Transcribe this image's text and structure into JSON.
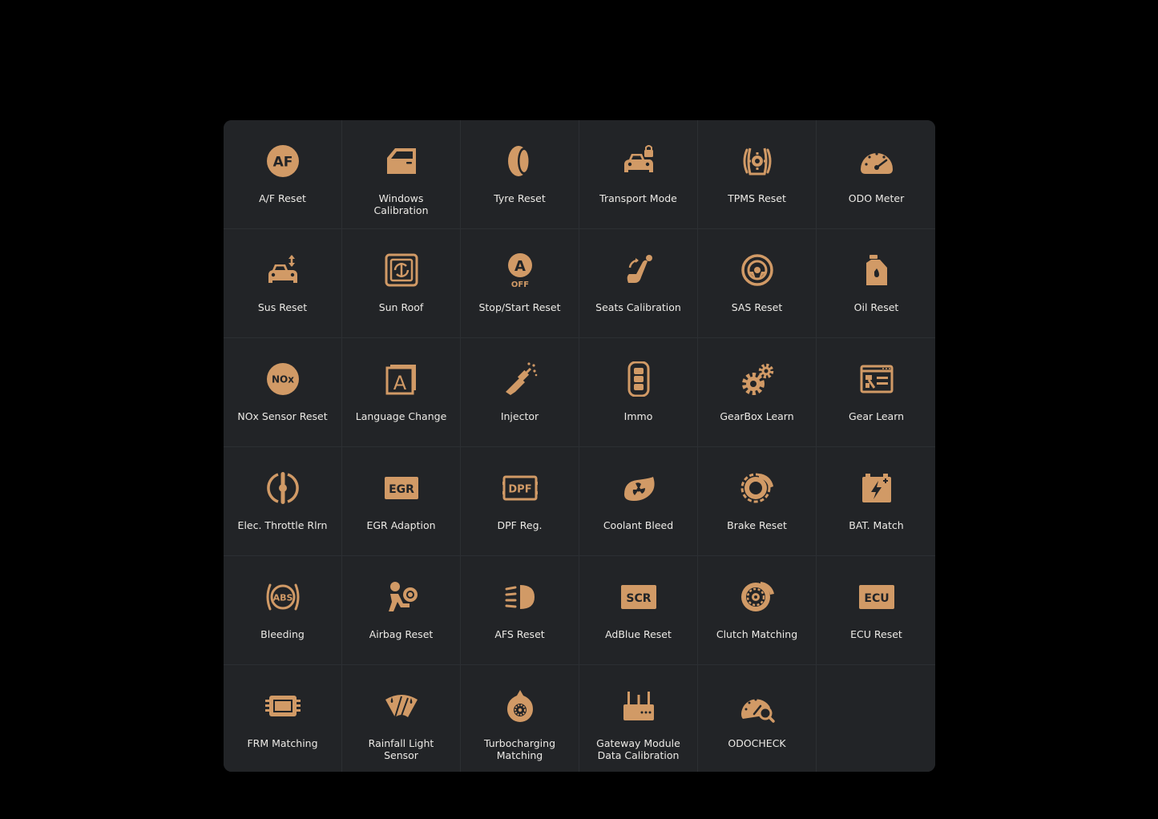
{
  "accent_color": "#d19a66",
  "panel_background": "#222427",
  "functions": [
    {
      "label": "A/F Reset",
      "icon": "af-icon",
      "badge": "AF"
    },
    {
      "label": "Windows\nCalibration",
      "icon": "car-window-icon"
    },
    {
      "label": "Tyre Reset",
      "icon": "tyre-icon"
    },
    {
      "label": "Transport Mode",
      "icon": "car-lock-icon"
    },
    {
      "label": "TPMS Reset",
      "icon": "tpms-icon"
    },
    {
      "label": "ODO Meter",
      "icon": "odometer-icon"
    },
    {
      "label": "Sus Reset",
      "icon": "suspension-icon"
    },
    {
      "label": "Sun Roof",
      "icon": "sunroof-icon"
    },
    {
      "label": "Stop/Start Reset",
      "icon": "stop-start-icon",
      "badge": "A",
      "sub_badge": "OFF"
    },
    {
      "label": "Seats Calibration",
      "icon": "seat-icon"
    },
    {
      "label": "SAS Reset",
      "icon": "steering-angle-icon"
    },
    {
      "label": "Oil Reset",
      "icon": "oil-can-icon"
    },
    {
      "label": "NOx Sensor Reset",
      "icon": "nox-icon",
      "badge": "NOx"
    },
    {
      "label": "Language Change",
      "icon": "language-icon",
      "badge": "A"
    },
    {
      "label": "Injector",
      "icon": "injector-icon"
    },
    {
      "label": "Immo",
      "icon": "key-fob-icon"
    },
    {
      "label": "GearBox Learn",
      "icon": "gears-icon"
    },
    {
      "label": "Gear Learn",
      "icon": "gear-learn-icon"
    },
    {
      "label": "Elec. Throttle Rlrn",
      "icon": "throttle-icon"
    },
    {
      "label": "EGR Adaption",
      "icon": "egr-icon",
      "badge": "EGR"
    },
    {
      "label": "DPF Reg.",
      "icon": "dpf-icon",
      "badge": "DPF"
    },
    {
      "label": "Coolant Bleed",
      "icon": "coolant-fan-icon"
    },
    {
      "label": "Brake Reset",
      "icon": "brake-disc-icon"
    },
    {
      "label": "BAT. Match",
      "icon": "battery-icon"
    },
    {
      "label": "Bleeding",
      "icon": "abs-icon",
      "badge": "ABS"
    },
    {
      "label": "Airbag Reset",
      "icon": "airbag-icon"
    },
    {
      "label": "AFS Reset",
      "icon": "headlight-icon"
    },
    {
      "label": "AdBlue Reset",
      "icon": "scr-icon",
      "badge": "SCR"
    },
    {
      "label": "Clutch Matching",
      "icon": "clutch-icon"
    },
    {
      "label": "ECU Reset",
      "icon": "ecu-icon",
      "badge": "ECU"
    },
    {
      "label": "FRM Matching",
      "icon": "frm-module-icon"
    },
    {
      "label": "Rainfall Light\nSensor",
      "icon": "rain-sensor-icon"
    },
    {
      "label": "Turbocharging\nMatching",
      "icon": "turbo-icon"
    },
    {
      "label": "Gateway Module\nData Calibration",
      "icon": "gateway-icon"
    },
    {
      "label": "ODOCHECK",
      "icon": "odo-check-icon"
    }
  ]
}
